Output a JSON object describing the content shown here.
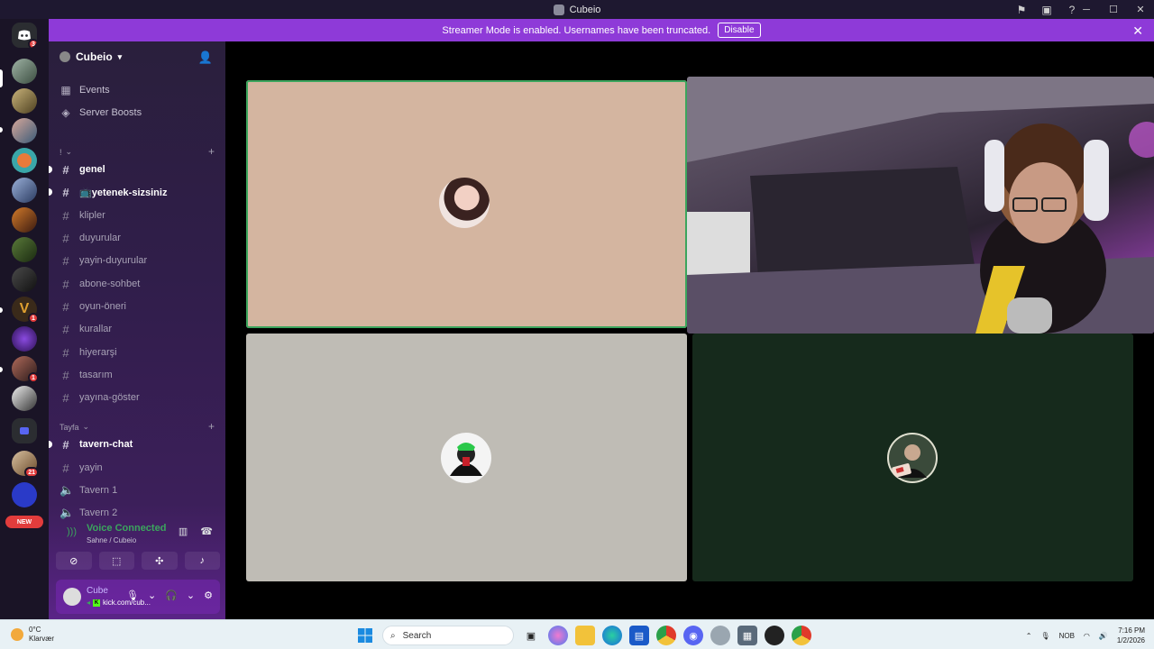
{
  "window": {
    "title": "Cubeio",
    "controls": [
      "minimize",
      "maximize",
      "close"
    ],
    "toolbar_icons": [
      "flag-icon",
      "inbox-icon",
      "help-icon"
    ]
  },
  "banner": {
    "text": "Streamer Mode is enabled. Usernames have been truncated.",
    "button": "Disable"
  },
  "guild_rail": {
    "badges": [
      "3",
      "1",
      "1",
      "21"
    ],
    "new_label": "NEW"
  },
  "server": {
    "name": "Cubeio",
    "links": [
      {
        "label": "Events",
        "icon": "calendar-icon"
      },
      {
        "label": "Server Boosts",
        "icon": "boost-icon"
      }
    ],
    "categories": [
      {
        "name": "!",
        "channels": [
          {
            "name": "genel",
            "type": "text",
            "unread": true
          },
          {
            "name": "yetenek-sizsiniz",
            "type": "text",
            "unread": true,
            "emoji": "📺"
          },
          {
            "name": "klipler",
            "type": "text",
            "unread": false
          },
          {
            "name": "duyurular",
            "type": "text",
            "unread": false
          },
          {
            "name": "yayin-duyurular",
            "type": "text",
            "unread": false
          },
          {
            "name": "abone-sohbet",
            "type": "text",
            "unread": false
          },
          {
            "name": "oyun-öneri",
            "type": "text",
            "unread": false
          },
          {
            "name": "kurallar",
            "type": "text",
            "unread": false
          },
          {
            "name": "hiyerarşi",
            "type": "text",
            "unread": false
          },
          {
            "name": "tasarım",
            "type": "text",
            "unread": false
          },
          {
            "name": "yayına-göster",
            "type": "text",
            "unread": false
          }
        ]
      },
      {
        "name": "Tayfa",
        "channels": [
          {
            "name": "tavern-chat",
            "type": "text",
            "unread": true
          },
          {
            "name": "yayin",
            "type": "text",
            "unread": false
          },
          {
            "name": "Tavern 1",
            "type": "voice",
            "unread": false
          },
          {
            "name": "Tavern 2",
            "type": "voice",
            "unread": false
          }
        ]
      }
    ]
  },
  "voice": {
    "status": "Voice Connected",
    "channel": "Sahne / Cubeio"
  },
  "user": {
    "name": "Cube",
    "status": "kick.com/cub..."
  },
  "taskbar": {
    "weather_temp": "0°C",
    "weather_desc": "Klarvær",
    "search_placeholder": "Search",
    "language": "NOB",
    "time": "7:16 PM",
    "date": "1/2/2026"
  },
  "colors": {
    "accent_purple": "#8e3ad8",
    "voice_green": "#3ba55d",
    "tile1_bg": "#d4b5a0",
    "tile3_bg": "#bfbcb5",
    "tile4_bg": "#162a1c"
  }
}
